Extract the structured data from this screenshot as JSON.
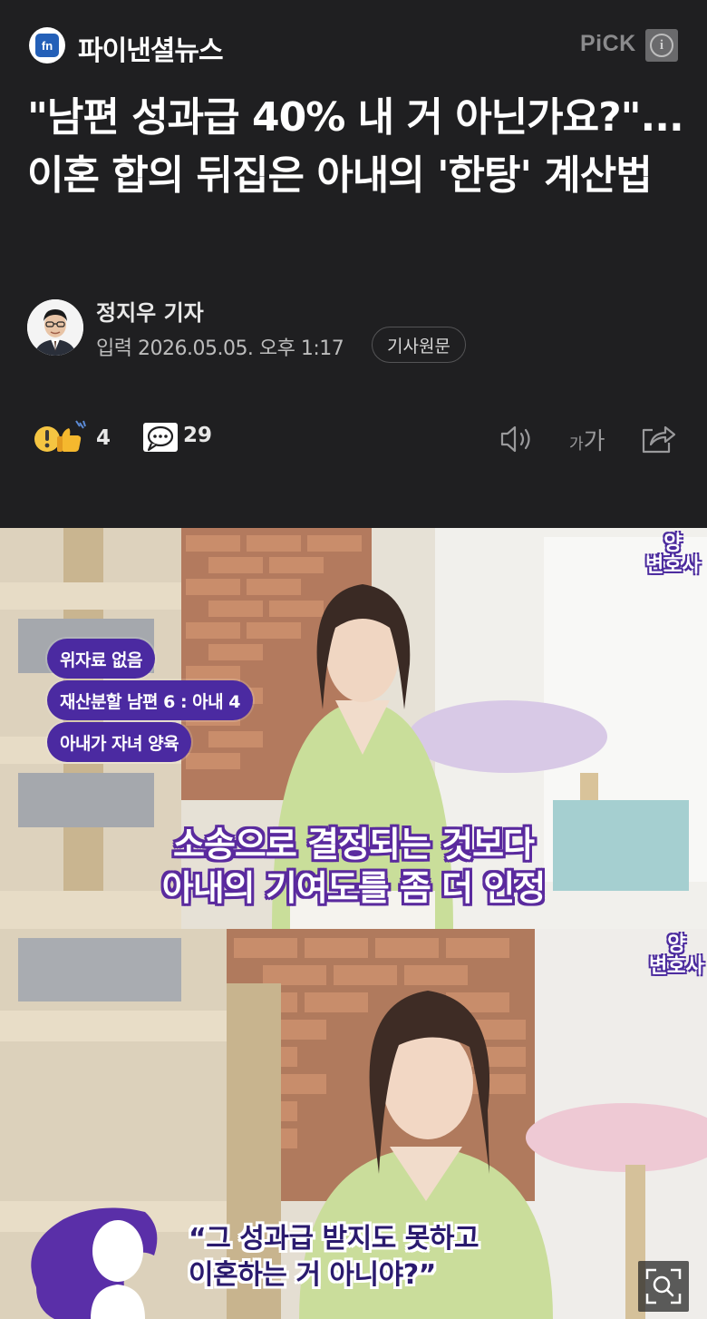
{
  "header": {
    "press_logo_text": "fn",
    "press_name": "파이낸셜뉴스",
    "pick_label": "PiCK",
    "info_icon": "info-icon"
  },
  "article": {
    "headline": "\"남편 성과급 40% 내 거 아닌가요?\"... 이혼 합의 뒤집은 아내의 '한탕' 계산법",
    "reporter_name": "정지우 기자",
    "publish_date": "입력 2026.05.05. 오후 1:17",
    "original_link_label": "기사원문"
  },
  "toolbar": {
    "reaction_count": "4",
    "comment_count": "29",
    "font_size_small": "가",
    "font_size_large": "가",
    "icons": [
      "reaction-icon",
      "comment-icon",
      "speaker-icon",
      "font-size-icon",
      "share-icon"
    ]
  },
  "photo1": {
    "pills": [
      "위자료 없음",
      "재산분할 남편 6 : 아내 4",
      "아내가 자녀 양육"
    ],
    "subtitle_line1": "소송으로 결정되는 것보다",
    "subtitle_line2": "아내의 기여도를 좀 더 인정",
    "channel_logo_line1": "양",
    "channel_logo_line2": "변호사"
  },
  "photo2": {
    "quote_line1": "“그 성과급 받지도 못하고",
    "quote_line2": "이혼하는 거 아니야?”",
    "channel_logo_line1": "양",
    "channel_logo_line2": "변호사"
  },
  "colors": {
    "background": "#1f1f21",
    "pill_purple": "#4b2aa1",
    "subtitle_outline": "#5a2a9e",
    "press_blue": "#2460b8"
  }
}
